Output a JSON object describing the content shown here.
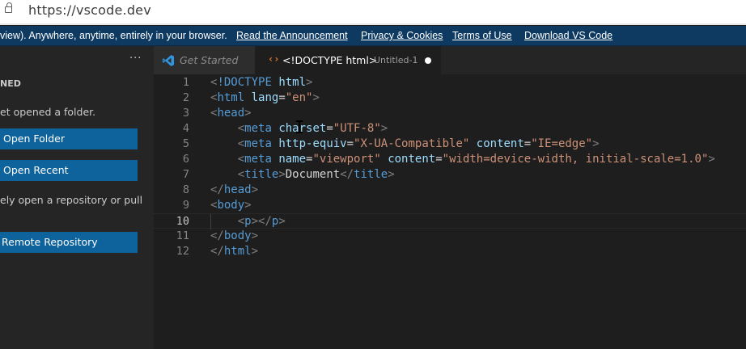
{
  "browser": {
    "url": "https://vscode.dev"
  },
  "banner": {
    "text": "view). Anywhere, anytime, entirely in your browser.",
    "links": [
      "Read the Announcement",
      "Privacy & Cookies",
      "Terms of Use",
      "Download VS Code"
    ]
  },
  "sidebar": {
    "more": "···",
    "section_title": "NED",
    "no_folder_text": "et opened a folder.",
    "open_folder_label": "Open Folder",
    "open_recent_label": "Open Recent",
    "repo_text": "ely open a repository or pull",
    "remote_repo_label": "Remote Repository"
  },
  "tabs": [
    {
      "label": "Get Started",
      "active": false,
      "icon": "vscode-logo-icon"
    },
    {
      "label": "<!DOCTYPE html>",
      "sub": "Untitled-1",
      "active": true,
      "dirty": true,
      "icon": "html-code-icon"
    }
  ],
  "editor": {
    "active_line": 10,
    "lines": [
      {
        "n": "1",
        "tokens": [
          [
            "t-punc",
            "<"
          ],
          [
            "t-tag",
            "!DOCTYPE"
          ],
          [
            "t-text",
            " "
          ],
          [
            "t-attr",
            "html"
          ],
          [
            "t-punc",
            ">"
          ]
        ]
      },
      {
        "n": "2",
        "tokens": [
          [
            "t-punc",
            "<"
          ],
          [
            "t-tag",
            "html"
          ],
          [
            "t-text",
            " "
          ],
          [
            "t-attr",
            "lang"
          ],
          [
            "t-text",
            "="
          ],
          [
            "t-str",
            "\"en\""
          ],
          [
            "t-punc",
            ">"
          ]
        ]
      },
      {
        "n": "3",
        "tokens": [
          [
            "t-punc",
            "<"
          ],
          [
            "t-tag",
            "head"
          ],
          [
            "t-punc",
            ">"
          ]
        ]
      },
      {
        "n": "4",
        "tokens": [
          [
            "t-text",
            "    "
          ],
          [
            "t-punc",
            "<"
          ],
          [
            "t-tag",
            "meta"
          ],
          [
            "t-text",
            " "
          ],
          [
            "t-attr",
            "charset"
          ],
          [
            "t-text",
            "="
          ],
          [
            "t-str",
            "\"UTF-8\""
          ],
          [
            "t-punc",
            ">"
          ]
        ]
      },
      {
        "n": "5",
        "tokens": [
          [
            "t-text",
            "    "
          ],
          [
            "t-punc",
            "<"
          ],
          [
            "t-tag",
            "meta"
          ],
          [
            "t-text",
            " "
          ],
          [
            "t-attr",
            "http-equiv"
          ],
          [
            "t-text",
            "="
          ],
          [
            "t-str",
            "\"X-UA-Compatible\""
          ],
          [
            "t-text",
            " "
          ],
          [
            "t-attr",
            "content"
          ],
          [
            "t-text",
            "="
          ],
          [
            "t-str",
            "\"IE=edge\""
          ],
          [
            "t-punc",
            ">"
          ]
        ]
      },
      {
        "n": "6",
        "tokens": [
          [
            "t-text",
            "    "
          ],
          [
            "t-punc",
            "<"
          ],
          [
            "t-tag",
            "meta"
          ],
          [
            "t-text",
            " "
          ],
          [
            "t-attr",
            "name"
          ],
          [
            "t-text",
            "="
          ],
          [
            "t-str",
            "\"viewport\""
          ],
          [
            "t-text",
            " "
          ],
          [
            "t-attr",
            "content"
          ],
          [
            "t-text",
            "="
          ],
          [
            "t-str",
            "\"width=device-width, initial-scale=1.0\""
          ],
          [
            "t-punc",
            ">"
          ]
        ]
      },
      {
        "n": "7",
        "tokens": [
          [
            "t-text",
            "    "
          ],
          [
            "t-punc",
            "<"
          ],
          [
            "t-tag",
            "title"
          ],
          [
            "t-punc",
            ">"
          ],
          [
            "t-text",
            "Document"
          ],
          [
            "t-punc",
            "</"
          ],
          [
            "t-tag",
            "title"
          ],
          [
            "t-punc",
            ">"
          ]
        ]
      },
      {
        "n": "8",
        "tokens": [
          [
            "t-punc",
            "</"
          ],
          [
            "t-tag",
            "head"
          ],
          [
            "t-punc",
            ">"
          ]
        ]
      },
      {
        "n": "9",
        "tokens": [
          [
            "t-punc",
            "<"
          ],
          [
            "t-tag",
            "body"
          ],
          [
            "t-punc",
            ">"
          ]
        ]
      },
      {
        "n": "10",
        "tokens": [
          [
            "t-text",
            "    "
          ],
          [
            "t-punc",
            "<"
          ],
          [
            "t-tag",
            "p"
          ],
          [
            "t-punc",
            "></"
          ],
          [
            "t-tag",
            "p"
          ],
          [
            "t-punc",
            ">"
          ]
        ]
      },
      {
        "n": "11",
        "tokens": [
          [
            "t-punc",
            "</"
          ],
          [
            "t-tag",
            "body"
          ],
          [
            "t-punc",
            ">"
          ]
        ]
      },
      {
        "n": "12",
        "tokens": [
          [
            "t-punc",
            "</"
          ],
          [
            "t-tag",
            "html"
          ],
          [
            "t-punc",
            ">"
          ]
        ]
      }
    ]
  },
  "colors": {
    "banner_bg": "#0e3a61",
    "button_bg": "#0e639c",
    "editor_bg": "#1e1e1e",
    "sidebar_bg": "#252526"
  }
}
